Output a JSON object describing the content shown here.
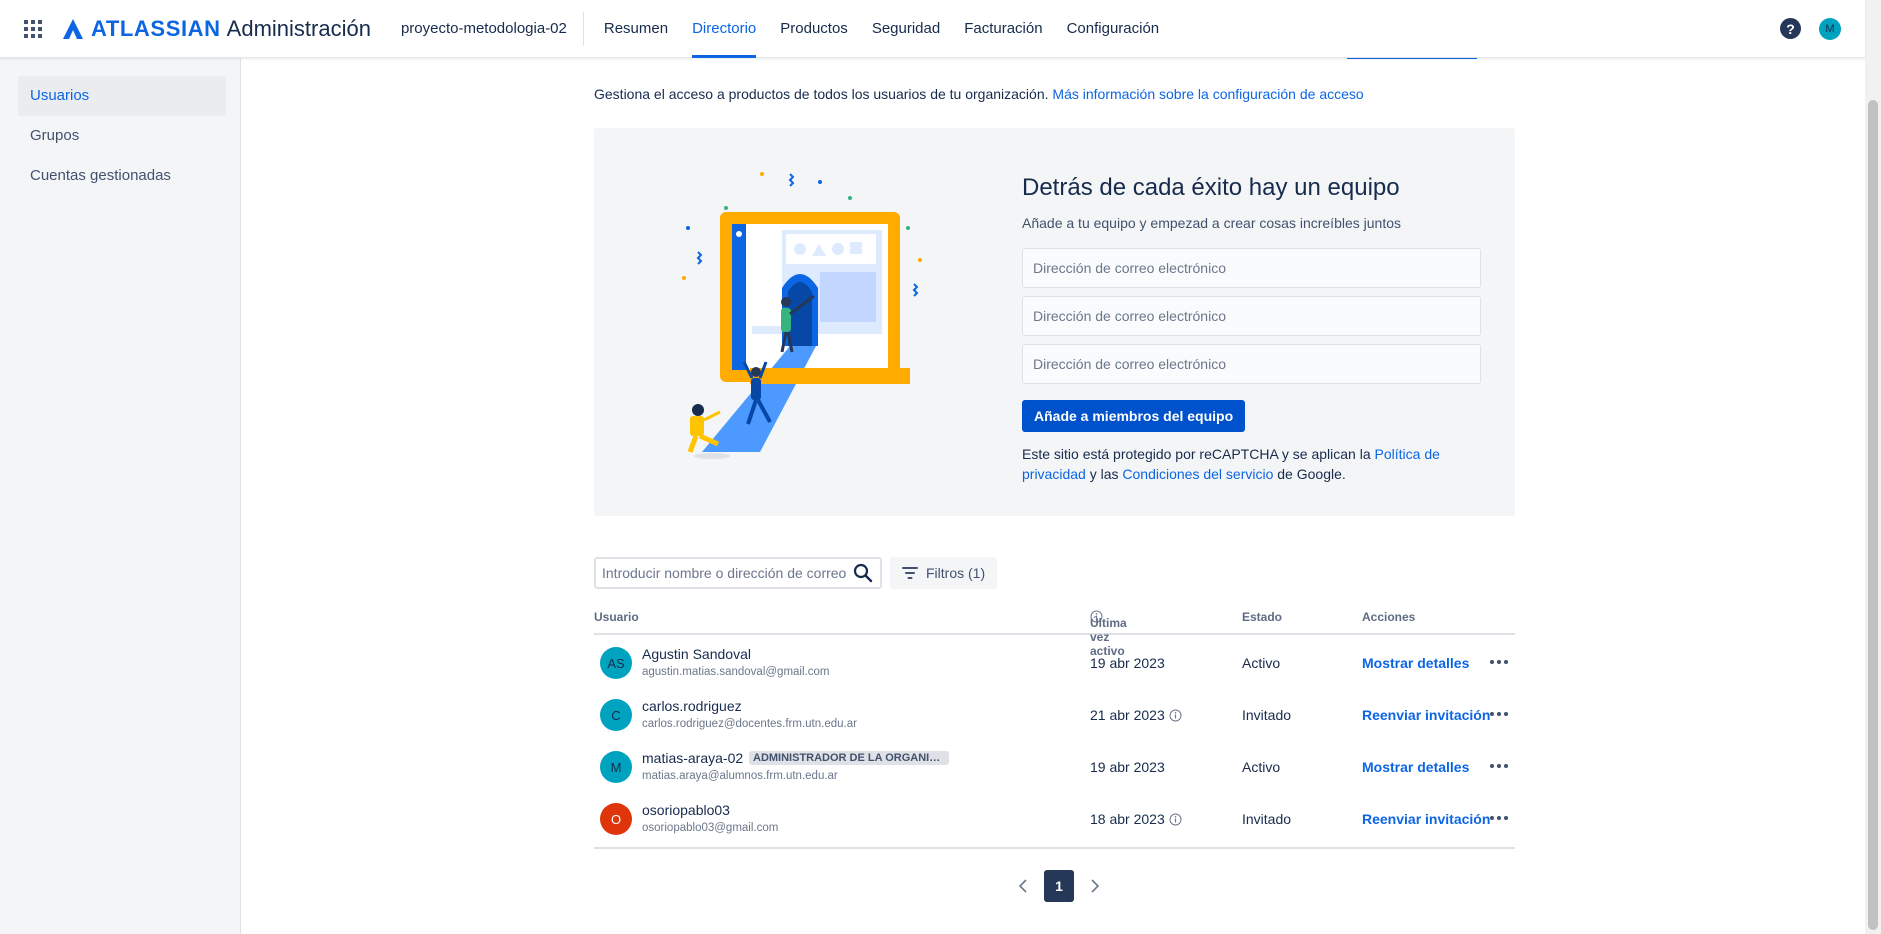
{
  "topnav": {
    "brand_word": "ATLASSIAN",
    "product": "Administración",
    "org": "proyecto-metodologia-02",
    "tabs": [
      {
        "label": "Resumen"
      },
      {
        "label": "Directorio"
      },
      {
        "label": "Productos"
      },
      {
        "label": "Seguridad"
      },
      {
        "label": "Facturación"
      },
      {
        "label": "Configuración"
      }
    ],
    "active_tab": "Directorio",
    "help_glyph": "?",
    "profile_initial": "M"
  },
  "sidebar": {
    "items": [
      {
        "label": "Usuarios"
      },
      {
        "label": "Grupos"
      },
      {
        "label": "Cuentas gestionadas"
      }
    ],
    "active_item": "Usuarios"
  },
  "intro": {
    "text": "Gestiona el acceso a productos de todos los usuarios de tu organización.",
    "link": "Más información sobre la configuración de acceso"
  },
  "invite": {
    "title": "Detrás de cada éxito hay un equipo",
    "subtitle": "Añade a tu equipo y empezad a crear cosas increíbles juntos",
    "email_placeholder": "Dirección de correo electrónico",
    "button": "Añade a miembros del equipo",
    "recaptcha_prefix": "Este sitio está protegido por reCAPTCHA y se aplican la",
    "privacy_link": "Política de privacidad",
    "recaptcha_middle": "y las",
    "terms_link": "Condiciones del servicio",
    "recaptcha_suffix": "de Google."
  },
  "search": {
    "placeholder": "Introducir nombre o dirección de correo electrónico",
    "filter_label": "Filtros (1)"
  },
  "table": {
    "columns": {
      "user": "Usuario",
      "last_active": "Última vez activo",
      "status": "Estado",
      "actions": "Acciones"
    },
    "rows": [
      {
        "initials": "AS",
        "name": "Agustin Sandoval",
        "email": "agustin.matias.sandoval@gmail.com",
        "badge": "",
        "date": "19 abr 2023",
        "status": "Activo",
        "action": "Mostrar detalles",
        "avatar_color": "#00a3bf",
        "avatar_text_color": "#172b4d"
      },
      {
        "initials": "C",
        "name": "carlos.rodriguez",
        "email": "carlos.rodriguez@docentes.frm.utn.edu.ar",
        "badge": "",
        "date": "21 abr 2023",
        "status": "Invitado",
        "action": "Reenviar invitación",
        "avatar_color": "#00a3bf",
        "avatar_text_color": "#172b4d"
      },
      {
        "initials": "M",
        "name": "matias-araya-02",
        "email": "matias.araya@alumnos.frm.utn.edu.ar",
        "badge": "ADMINISTRADOR DE LA ORGANIZ...",
        "date": "19 abr 2023",
        "status": "Activo",
        "action": "Mostrar detalles",
        "avatar_color": "#00a3bf",
        "avatar_text_color": "#172b4d"
      },
      {
        "initials": "O",
        "name": "osoriopablo03",
        "email": "osoriopablo03@gmail.com",
        "badge": "",
        "date": "18 abr 2023",
        "status": "Invitado",
        "action": "Reenviar invitación",
        "avatar_color": "#de350b",
        "avatar_text_color": "#ffffff"
      }
    ]
  },
  "pagination": {
    "current": "1"
  },
  "colors": {
    "brand_blue": "#0c66e4",
    "button_blue": "#0052cc",
    "sidebar_bg": "#f4f5f7",
    "page_chip": "#253858"
  }
}
